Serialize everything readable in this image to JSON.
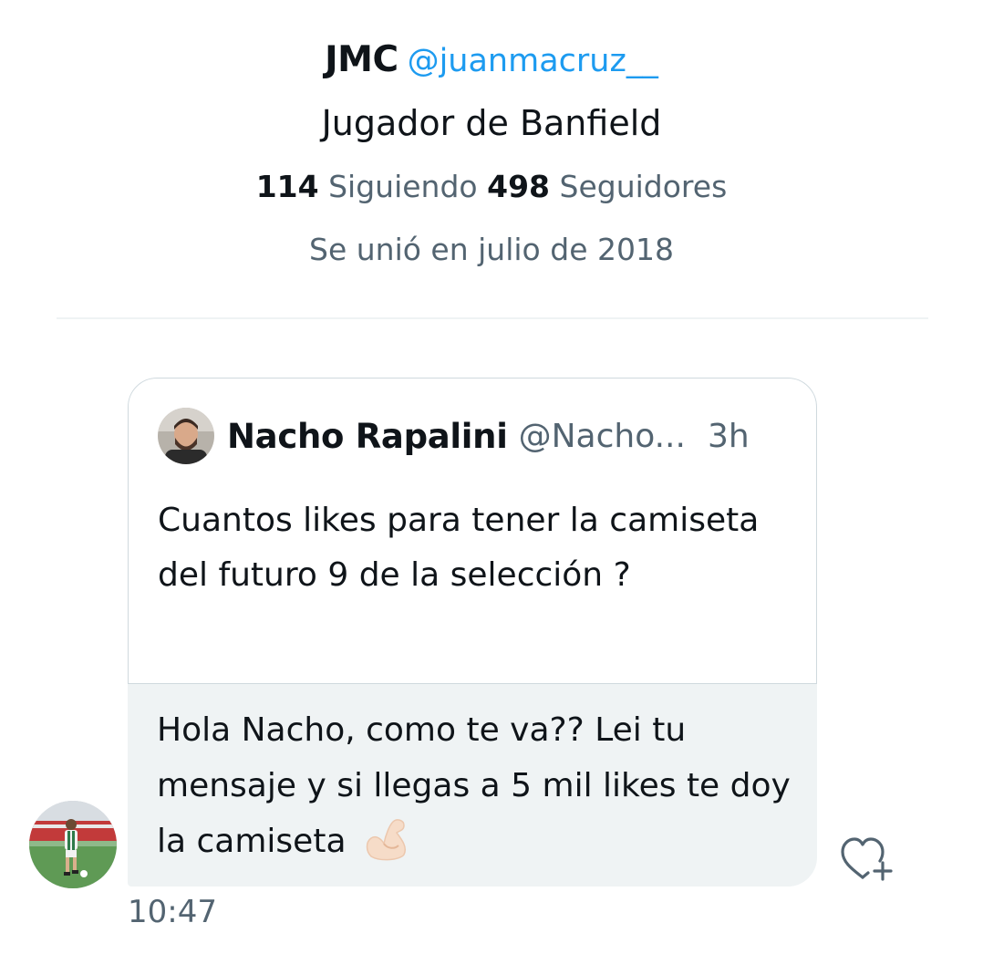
{
  "profile": {
    "display_name": "JMC",
    "handle": "@juanmacruz__",
    "bio": "Jugador de Banfield",
    "following_count": "114",
    "following_label": "Siguiendo",
    "followers_count": "498",
    "followers_label": "Seguidores",
    "joined": "Se unió en julio de 2018"
  },
  "message": {
    "quoted_tweet": {
      "author_name": "Nacho Rapalini",
      "author_handle": "@Nacho...",
      "time_ago": "3h",
      "text": "Cuantos likes para tener la camiseta del futuro 9 de la selección ?"
    },
    "reply_text": "Hola Nacho, como te va?? Lei tu mensaje y si llegas a 5 mil likes te doy la camiseta",
    "reply_emoji": "flexed-biceps-emoji",
    "timestamp": "10:47",
    "react_icon": "heart-plus-icon"
  },
  "colors": {
    "accent": "#1d9bf0",
    "secondary_text": "#536471",
    "bubble_bg": "#eff3f4",
    "border": "#cfd9de"
  }
}
